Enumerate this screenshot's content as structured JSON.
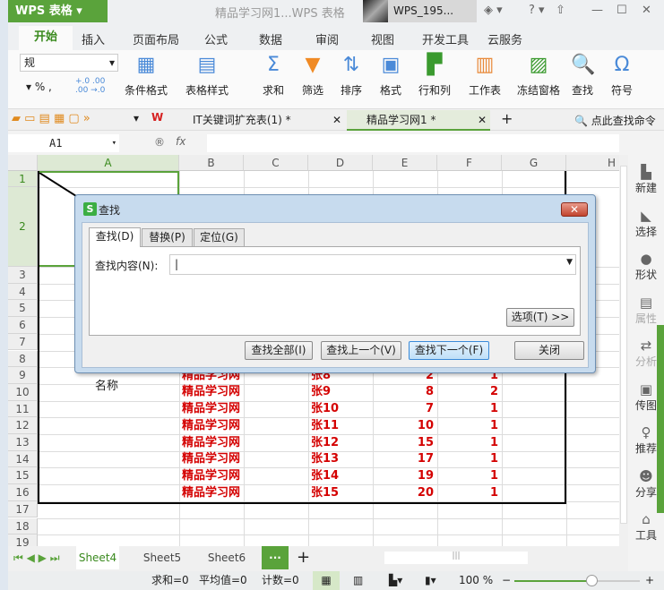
{
  "app": {
    "logo": "WPS 表格",
    "doc_title": "精品学习网1...WPS 表格",
    "user": "WPS_195..."
  },
  "menu": [
    "开始",
    "插入",
    "页面布局",
    "公式",
    "数据",
    "审阅",
    "视图",
    "开发工具",
    "云服务"
  ],
  "ribbon": {
    "number_format": "规",
    "buttons": [
      {
        "label": "条件格式",
        "icon": "conditional-format"
      },
      {
        "label": "表格样式",
        "icon": "table-style"
      },
      {
        "label": "求和",
        "icon": "sigma"
      },
      {
        "label": "筛选",
        "icon": "filter"
      },
      {
        "label": "排序",
        "icon": "sort"
      },
      {
        "label": "格式",
        "icon": "format"
      },
      {
        "label": "行和列",
        "icon": "rows-cols"
      },
      {
        "label": "工作表",
        "icon": "worksheet"
      },
      {
        "label": "冻结窗格",
        "icon": "freeze"
      },
      {
        "label": "查找",
        "icon": "find"
      },
      {
        "label": "符号",
        "icon": "omega"
      }
    ]
  },
  "tabs": [
    {
      "label": "IT关键词扩充表(1) *"
    },
    {
      "label": "精品学习网1 *"
    }
  ],
  "search_command": "点此查找命令",
  "name_box": "A1",
  "fx": "fx",
  "columns": [
    "A",
    "B",
    "C",
    "D",
    "E",
    "F",
    "G",
    "H"
  ],
  "rows": [
    "1",
    "2",
    "3",
    "4",
    "5",
    "6",
    "7",
    "8",
    "9",
    "10",
    "11",
    "12",
    "13",
    "14",
    "15",
    "16",
    "17",
    "18",
    "19"
  ],
  "label_cell": "名称",
  "data_rows": [
    [
      "精品学习网",
      "张8",
      "2",
      "1"
    ],
    [
      "精品学习网",
      "张9",
      "8",
      "2"
    ],
    [
      "精品学习网",
      "张10",
      "7",
      "1"
    ],
    [
      "精品学习网",
      "张11",
      "10",
      "1"
    ],
    [
      "精品学习网",
      "张12",
      "15",
      "1"
    ],
    [
      "精品学习网",
      "张13",
      "17",
      "1"
    ],
    [
      "精品学习网",
      "张14",
      "19",
      "1"
    ],
    [
      "精品学习网",
      "张15",
      "20",
      "1"
    ]
  ],
  "dialog": {
    "title": "查找",
    "tabs": [
      "查找(D)",
      "替换(P)",
      "定位(G)"
    ],
    "find_label": "查找内容(N):",
    "find_value": "",
    "options": "选项(T) >>",
    "find_all": "查找全部(I)",
    "find_prev": "查找上一个(V)",
    "find_next": "查找下一个(F)",
    "close": "关闭"
  },
  "right_panel": [
    {
      "label": "新建",
      "icon": "▙"
    },
    {
      "label": "选择",
      "icon": "◣"
    },
    {
      "label": "形状",
      "icon": "●"
    },
    {
      "label": "属性",
      "icon": "▤"
    },
    {
      "label": "分析",
      "icon": "⇄"
    },
    {
      "label": "传图",
      "icon": "▣"
    },
    {
      "label": "推荐",
      "icon": "♀"
    },
    {
      "label": "分享",
      "icon": "☻"
    },
    {
      "label": "工具",
      "icon": "⌂"
    }
  ],
  "sheets": [
    "Sheet4",
    "Sheet5",
    "Sheet6"
  ],
  "status": {
    "sum": "求和=0",
    "avg": "平均值=0",
    "count": "计数=0",
    "zoom": "100 %"
  },
  "colors": {
    "accent": "#5aa33b",
    "data_text": "#d40000"
  }
}
